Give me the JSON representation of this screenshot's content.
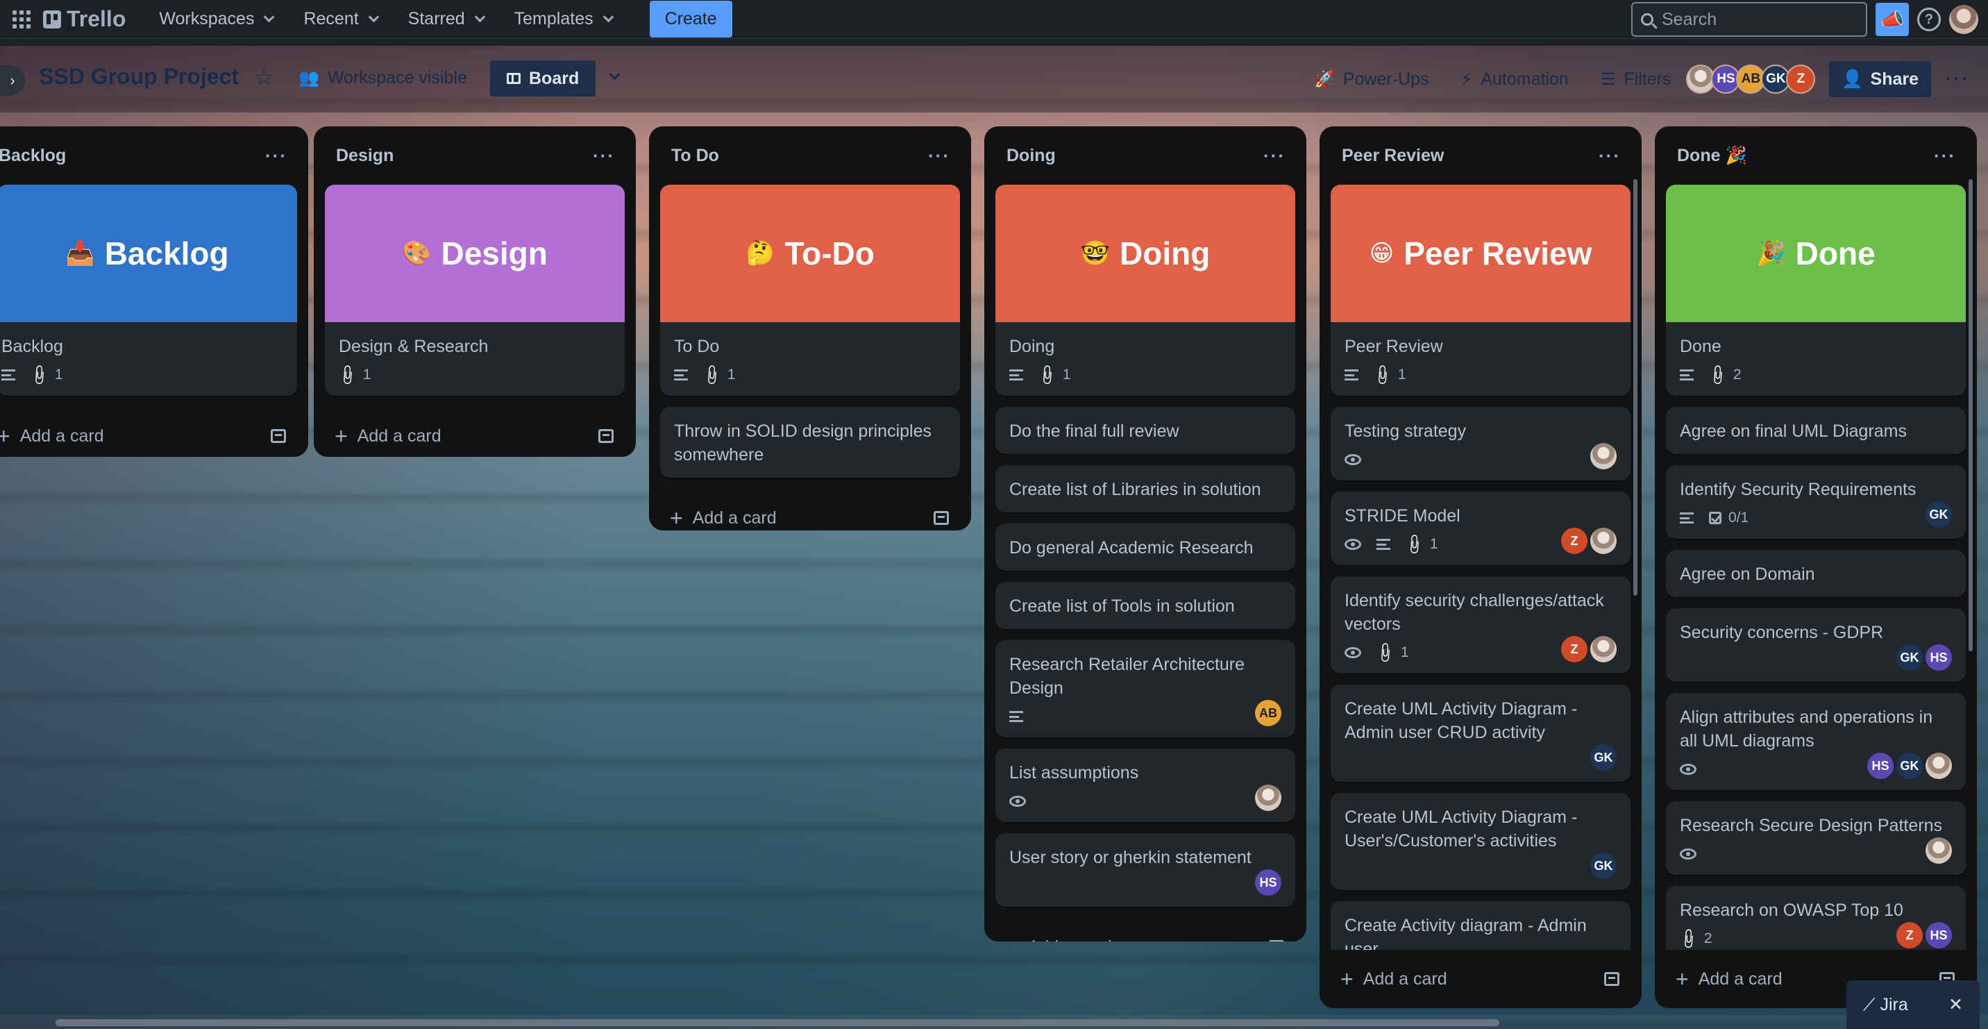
{
  "topnav": {
    "logo": "Trello",
    "menus": [
      "Workspaces",
      "Recent",
      "Starred",
      "Templates"
    ],
    "create": "Create",
    "search_placeholder": "Search"
  },
  "board": {
    "title": "SSD Group Project",
    "visibility": "Workspace visible",
    "view": "Board",
    "powerups": "Power-Ups",
    "automation": "Automation",
    "filters": "Filters",
    "share": "Share",
    "members": [
      "photo",
      "HS",
      "AB",
      "GK",
      "Z"
    ]
  },
  "colors": {
    "blue": "#2f74c8",
    "purple": "#b46fd6",
    "red": "#e06048",
    "green": "#6cc04a",
    "accent": "#579dff"
  },
  "lists": [
    {
      "title": "Backlog",
      "cover": {
        "emoji": "📥",
        "text": "Backlog",
        "color": "#2f74c8"
      },
      "cards": [
        {
          "title": "Backlog",
          "desc": true,
          "attachments": "1"
        }
      ],
      "add": "Add a card"
    },
    {
      "title": "Design",
      "cover": {
        "emoji": "🎨",
        "text": "Design",
        "color": "#b46fd6"
      },
      "cards": [
        {
          "title": "Design & Research",
          "attachments": "1"
        }
      ],
      "add": "Add a card"
    },
    {
      "title": "To Do",
      "cover": {
        "emoji": "🤔",
        "text": "To-Do",
        "color": "#e06048"
      },
      "cards": [
        {
          "title": "To Do",
          "desc": true,
          "attachments": "1"
        },
        {
          "title": "Throw in SOLID design principles somewhere"
        }
      ],
      "add": "Add a card"
    },
    {
      "title": "Doing",
      "cover": {
        "emoji": "🤓",
        "text": "Doing",
        "color": "#e06048"
      },
      "cards": [
        {
          "title": "Doing",
          "desc": true,
          "attachments": "1"
        },
        {
          "title": "Do the final full review"
        },
        {
          "title": "Create list of Libraries in solution"
        },
        {
          "title": "Do general Academic Research"
        },
        {
          "title": "Create list of Tools in solution"
        },
        {
          "title": "Research Retailer Architecture Design",
          "desc": true,
          "members": [
            "AB"
          ]
        },
        {
          "title": "List assumptions",
          "watch": true,
          "members": [
            "photo"
          ]
        },
        {
          "title": "User story or gherkin statement",
          "members": [
            "HS"
          ]
        }
      ],
      "add": "Add a card"
    },
    {
      "title": "Peer Review",
      "cover": {
        "emoji": "😁",
        "text": "Peer Review",
        "color": "#e06048"
      },
      "cards": [
        {
          "title": "Peer Review",
          "desc": true,
          "attachments": "1"
        },
        {
          "title": "Testing strategy",
          "watch": true,
          "members": [
            "photo"
          ]
        },
        {
          "title": "STRIDE Model",
          "watch": true,
          "desc": true,
          "attachments": "1",
          "members": [
            "Z",
            "photo"
          ]
        },
        {
          "title": "Identify security challenges/attack vectors",
          "watch": true,
          "attachments": "1",
          "members": [
            "Z",
            "photo"
          ]
        },
        {
          "title": "Create UML Activity Diagram - Admin user CRUD activity",
          "members": [
            "GK"
          ]
        },
        {
          "title": "Create UML Activity Diagram - User's/Customer's activities",
          "members": [
            "GK"
          ]
        },
        {
          "title": "Create Activity diagram - Admin user"
        }
      ],
      "add": "Add a card"
    },
    {
      "title": "Done 🎉",
      "cover": {
        "emoji": "🎉",
        "text": "Done",
        "color": "#6cc04a"
      },
      "cards": [
        {
          "title": "Done",
          "desc": true,
          "attachments": "2"
        },
        {
          "title": "Agree on final UML Diagrams"
        },
        {
          "title": "Identify Security Requirements",
          "desc": true,
          "checklist": "0/1",
          "members": [
            "GK"
          ]
        },
        {
          "title": "Agree on Domain"
        },
        {
          "title": "Security concerns - GDPR",
          "members": [
            "GK",
            "HS"
          ]
        },
        {
          "title": "Align attributes and operations in all UML diagrams",
          "watch": true,
          "members": [
            "HS",
            "GK",
            "photo"
          ]
        },
        {
          "title": "Research Secure Design Patterns",
          "watch": true,
          "members": [
            "photo"
          ]
        },
        {
          "title": "Research on OWASP Top 10",
          "attachments": "2",
          "members": [
            "Z",
            "HS"
          ]
        }
      ],
      "add": "Add a card"
    }
  ],
  "jira": {
    "label": "Jira",
    "close": "✕"
  }
}
